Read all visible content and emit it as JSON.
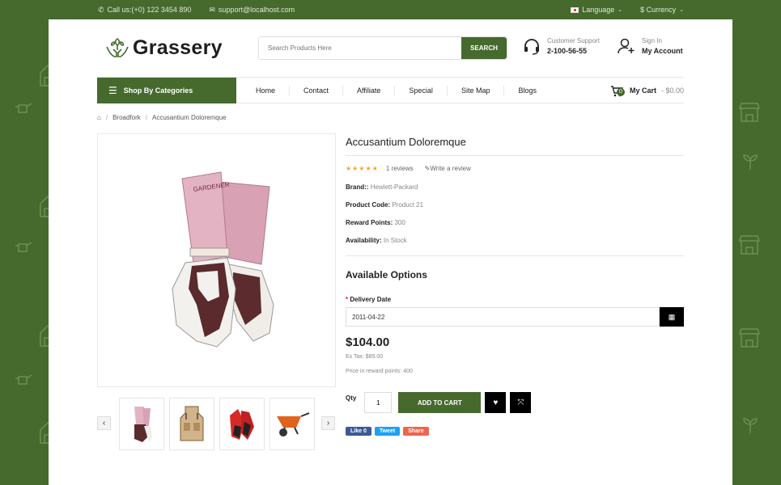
{
  "topbar": {
    "call": "Call us:(+0) 122 3454 890",
    "email": "support@localhost.com",
    "language": "Language",
    "currency": "$ Currency"
  },
  "brand": {
    "name": "Grassery"
  },
  "search": {
    "placeholder": "Search Products Here",
    "button": "SEARCH"
  },
  "support": {
    "label": "Customer Support",
    "phone": "2-100-56-55"
  },
  "account": {
    "signin": "Sign In",
    "label": "My Account"
  },
  "nav": {
    "categories": "Shop By Categories",
    "items": [
      "Home",
      "Contact",
      "Affiliate",
      "Special",
      "Site Map",
      "Blogs"
    ]
  },
  "cart": {
    "count": "0",
    "label": "My Cart",
    "amount": "- $0.00"
  },
  "breadcrumb": [
    "Broadfork",
    "Accusantium Doloremque"
  ],
  "product": {
    "title": "Accusantium Doloremque",
    "stars": "★★★★★",
    "reviews": "1 reviews",
    "write_review": "Write a review",
    "brand_label": "Brand::",
    "brand_value": "Hewlett-Packard",
    "code_label": "Product Code:",
    "code_value": "Product 21",
    "points_label": "Reward Points:",
    "points_value": "300",
    "avail_label": "Availability:",
    "avail_value": "In Stock",
    "options_title": "Available Options",
    "delivery_label": "Delivery Date",
    "delivery_value": "2011-04-22",
    "price": "$104.00",
    "ex_tax": "Ex Tax: $85.00",
    "reward_price": "Price in reward points: 400",
    "qty_label": "Qty",
    "qty_value": "1",
    "add_to_cart": "ADD TO CART"
  },
  "social": {
    "like": "Like 0",
    "tweet": "Tweet",
    "share": "Share"
  },
  "colors": {
    "brand_green": "#466a2e",
    "star": "#f5a623"
  }
}
